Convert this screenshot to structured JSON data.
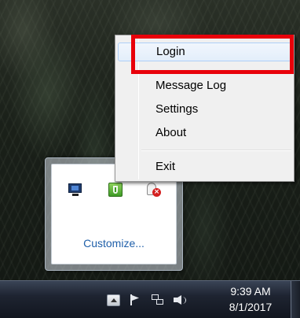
{
  "context_menu": {
    "items": [
      {
        "label": "Login"
      },
      {
        "label": "Message Log"
      },
      {
        "label": "Settings"
      },
      {
        "label": "About"
      },
      {
        "label": "Exit"
      }
    ],
    "highlighted_item": "Login",
    "highlight_color": "#e8000a"
  },
  "tray_overflow": {
    "icons": [
      "monitor-icon",
      "shield-app-icon",
      "user-error-icon"
    ],
    "customize_label": "Customize..."
  },
  "taskbar": {
    "tray_icons": [
      "show-hidden-icons-arrow",
      "action-center-flag-icon",
      "network-icon",
      "volume-icon"
    ],
    "clock": {
      "time": "9:39 AM",
      "date": "8/1/2017"
    }
  }
}
